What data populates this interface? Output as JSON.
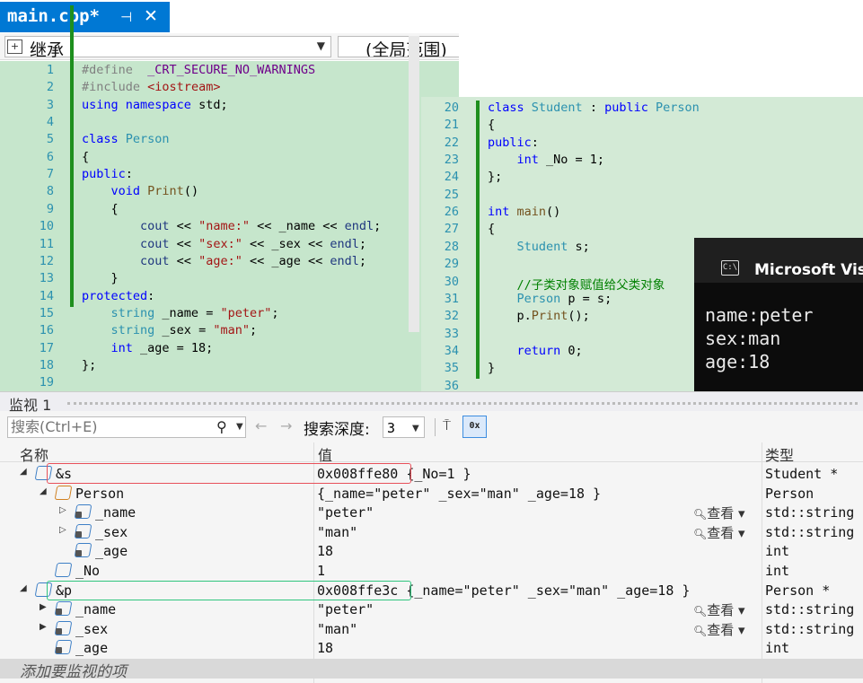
{
  "tab": {
    "title": "main.cpp*",
    "pin_icon": "pin-icon",
    "close_icon": "close-icon"
  },
  "nav": {
    "left": "继承",
    "right": "(全局范围)"
  },
  "left_code": {
    "line_numbers": [
      "1",
      "2",
      "3",
      "4",
      "5",
      "6",
      "7",
      "8",
      "9",
      "10",
      "11",
      "12",
      "13",
      "14",
      "15",
      "16",
      "17",
      "18",
      "19"
    ],
    "lines": [
      "#define  _CRT_SECURE_NO_WARNINGS",
      "#include <iostream>",
      "using namespace std;",
      "",
      "class Person",
      "{",
      "public:",
      "    void Print()",
      "    {",
      "        cout << \"name:\" << _name << endl;",
      "        cout << \"sex:\" << _sex << endl;",
      "        cout << \"age:\" << _age << endl;",
      "    }",
      "protected:",
      "    string _name = \"peter\";",
      "    string _sex = \"man\";",
      "    int _age = 18;",
      "};",
      ""
    ]
  },
  "right_code": {
    "line_numbers": [
      "20",
      "21",
      "22",
      "23",
      "24",
      "25",
      "26",
      "27",
      "28",
      "29",
      "30",
      "31",
      "32",
      "33",
      "34",
      "35",
      "36"
    ],
    "lines": [
      "class Student : public Person",
      "{",
      "public:",
      "    int _No = 1;",
      "};",
      "",
      "int main()",
      "{",
      "    Student s;",
      "",
      "    //子类对象赋值给父类对象",
      "    Person p = s;",
      "    p.Print();",
      "",
      "    return 0;",
      "}",
      ""
    ]
  },
  "console": {
    "title": "Microsoft Visu",
    "icon_text": "C:\\",
    "lines": [
      "name:peter",
      "sex:man",
      "age:18"
    ]
  },
  "watch": {
    "title": "监视 1",
    "search_placeholder": "搜索(Ctrl+E)",
    "depth_label": "搜索深度:",
    "depth_value": "3",
    "hex_icon_text": "0x",
    "columns": {
      "name": "名称",
      "value": "值",
      "type": "类型"
    },
    "view_label": "查看",
    "rows": [
      {
        "name": "&s",
        "value": "0x008ffe80 {_No=1 }",
        "type": "Student *"
      },
      {
        "name": "Person",
        "value": "{_name=\"peter\" _sex=\"man\" _age=18 }",
        "type": "Person"
      },
      {
        "name": "_name",
        "value": "\"peter\"",
        "type": "std::string"
      },
      {
        "name": "_sex",
        "value": "\"man\"",
        "type": "std::string"
      },
      {
        "name": "_age",
        "value": "18",
        "type": "int"
      },
      {
        "name": "_No",
        "value": "1",
        "type": "int"
      },
      {
        "name": "&p",
        "value": "0x008ffe3c {_name=\"peter\" _sex=\"man\" _age=18 }",
        "type": "Person *"
      },
      {
        "name": "_name",
        "value": "\"peter\"",
        "type": "std::string"
      },
      {
        "name": "_sex",
        "value": "\"man\"",
        "type": "std::string"
      },
      {
        "name": "_age",
        "value": "18",
        "type": "int"
      }
    ],
    "add_item": "添加要监视的项"
  },
  "colors": {
    "accent": "#0078d4",
    "code_bg": "#c6e6cc",
    "red_highlight": "#e8505a",
    "green_highlight": "#2fc57e"
  }
}
